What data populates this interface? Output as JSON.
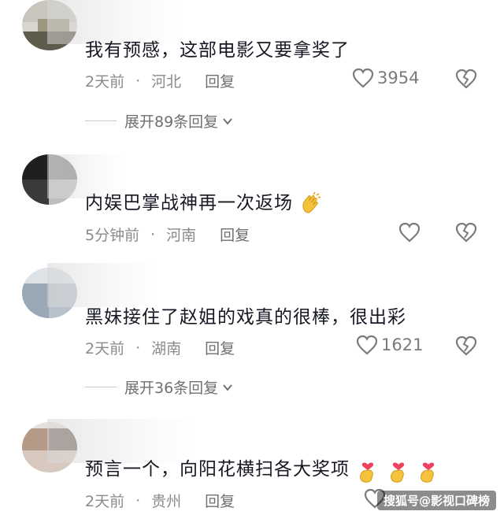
{
  "comments": [
    {
      "text": "我有预感，这部电影又要拿奖了",
      "time": "2天前",
      "location": "河北",
      "reply_label": "回复",
      "likes": "3954",
      "expand_label": "展开89条回复"
    },
    {
      "text": "内娱巴掌战神再一次返场",
      "time": "5分钟前",
      "location": "河南",
      "reply_label": "回复",
      "likes": ""
    },
    {
      "text": "黑妹接住了赵姐的戏真的很棒，很出彩",
      "time": "2天前",
      "location": "湖南",
      "reply_label": "回复",
      "likes": "1621",
      "expand_label": "展开36条回复"
    },
    {
      "text": "预言一个，向阳花横扫各大奖项",
      "time": "2天前",
      "location": "贵州",
      "reply_label": "回复",
      "likes": ""
    }
  ],
  "separator": "·",
  "watermark": "搜狐号@影视口碑榜",
  "colors": {
    "text": "#161823",
    "meta": "#8a8a8f",
    "icon": "#7a7a7f"
  }
}
